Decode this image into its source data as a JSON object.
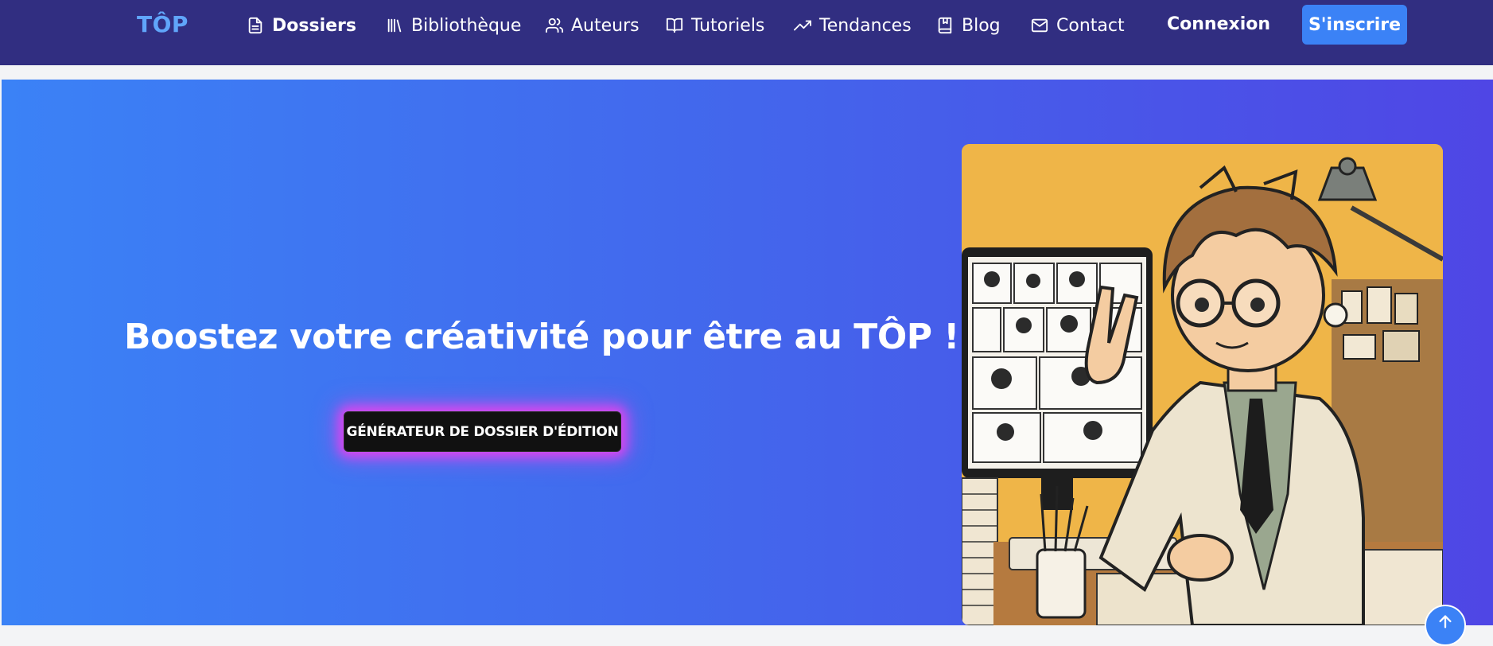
{
  "brand": {
    "name": "TÔP"
  },
  "nav": {
    "items": [
      {
        "label": "Dossiers",
        "icon": "document-icon"
      },
      {
        "label": "Bibliothèque",
        "icon": "library-icon"
      },
      {
        "label": "Auteurs",
        "icon": "users-icon"
      },
      {
        "label": "Tutoriels",
        "icon": "book-open-icon"
      },
      {
        "label": "Tendances",
        "icon": "trending-up-icon"
      },
      {
        "label": "Blog",
        "icon": "bookmark-book-icon"
      },
      {
        "label": "Contact",
        "icon": "mail-icon"
      }
    ],
    "login_label": "Connexion",
    "signup_label": "S'inscrire"
  },
  "hero": {
    "title": "Boostez votre créativité pour être au TÔP !",
    "cta_label": "GÉNÉRATEUR DE DOSSIER D'ÉDITION",
    "image": "manga-artist-illustration"
  },
  "colors": {
    "navbar": "#312e81",
    "brand": "#60a5fa",
    "accent": "#3b82f6",
    "hero_gradient_start": "#3b82f6",
    "hero_gradient_end": "#4f46e5",
    "cta_glow": "#d946ef"
  }
}
